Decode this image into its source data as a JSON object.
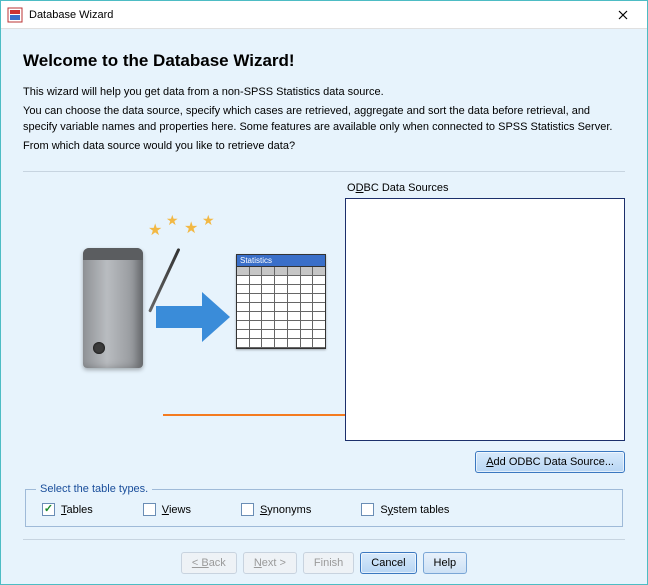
{
  "window": {
    "title": "Database Wizard"
  },
  "heading": "Welcome to the Database Wizard!",
  "intro": {
    "line1": "This wizard will help you get data from a non-SPSS Statistics data source.",
    "line2": "You can choose the data source, specify which cases are retrieved, aggregate and sort the data before retrieval, and specify variable names and properties here. Some features are available only when connected to SPSS Statistics Server.",
    "line3": "From which data source would you like to retrieve data?"
  },
  "illustration": {
    "grid_header": "Statistics"
  },
  "datasources": {
    "label_pre": "O",
    "label_u": "D",
    "label_post": "BC Data Sources",
    "items": [],
    "add_button_pre": "",
    "add_button_u": "A",
    "add_button_post": "dd ODBC Data Source..."
  },
  "types": {
    "legend": "Select the table types.",
    "options": [
      {
        "u": "T",
        "rest": "ables",
        "checked": true
      },
      {
        "u": "V",
        "rest": "iews",
        "checked": false
      },
      {
        "u": "S",
        "rest": "ynonyms",
        "checked": false
      },
      {
        "pre": "S",
        "u": "y",
        "rest": "stem tables",
        "checked": false
      }
    ]
  },
  "buttons": {
    "back": "< Back",
    "next": "Next >",
    "finish": "Finish",
    "cancel": "Cancel",
    "help": "Help"
  }
}
